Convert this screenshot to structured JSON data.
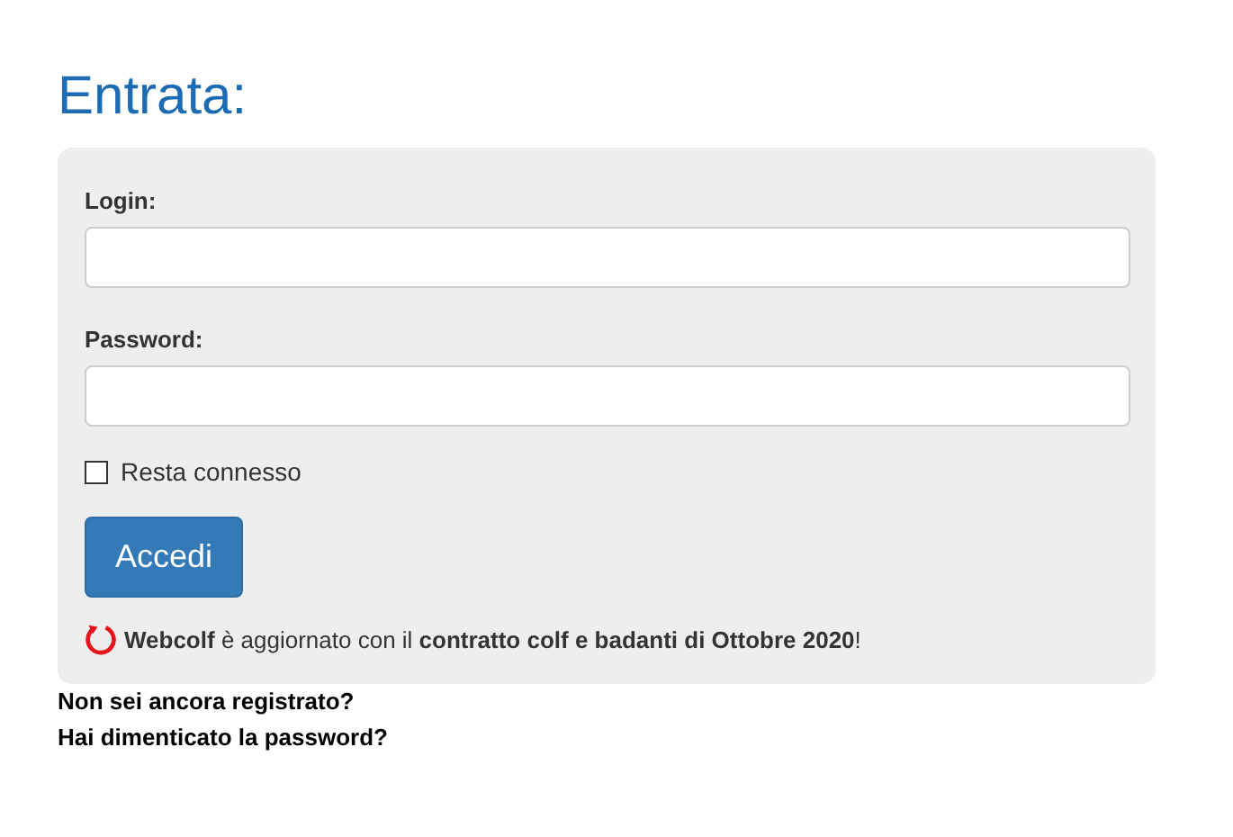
{
  "title": "Entrata:",
  "fields": [
    {
      "label": "Login:"
    },
    {
      "label": "Password:"
    }
  ],
  "remember": {
    "label": "Resta connesso",
    "checked": false
  },
  "submit": "Accedi",
  "notice": "**Webcolf** è aggiornato con il **contratto colf e badanti di Ottobre 2020**!",
  "links": [
    "Non sei ancora registrato?",
    "Hai dimenticato la password?"
  ]
}
